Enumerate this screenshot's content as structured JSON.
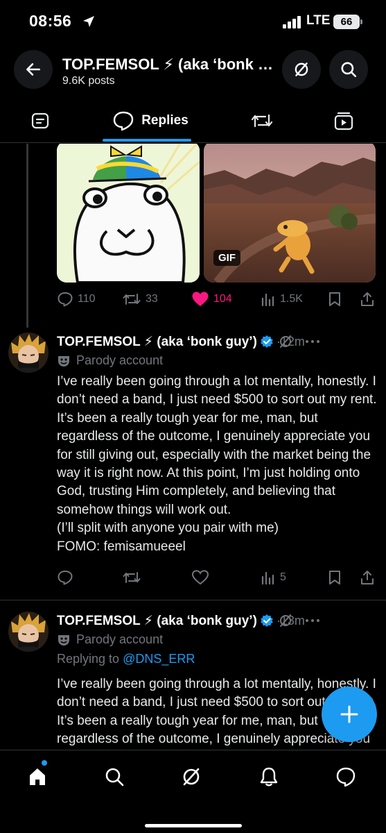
{
  "status_bar": {
    "time": "08:56",
    "network": "LTE",
    "battery": "66"
  },
  "header": {
    "title": "TOP.FEMSOL ⚡ (aka ‘bonk guy’)",
    "subtitle": "9.6K posts"
  },
  "tabs": [
    {
      "label": "",
      "icon": "post-icon"
    },
    {
      "label": "Replies",
      "icon": "reply-bubble-icon",
      "active": true
    },
    {
      "label": "",
      "icon": "repost-icon"
    },
    {
      "label": "",
      "icon": "media-icon"
    }
  ],
  "media": {
    "gif_badge": "GIF"
  },
  "top_actions": {
    "replies": "110",
    "reposts": "33",
    "likes": "104",
    "views": "1.5K"
  },
  "posts": [
    {
      "name": "TOP.FEMSOL ⚡ (aka ‘bonk guy’)",
      "time": "·12m",
      "badge": "Parody account",
      "body": "I’ve really been going through a lot mentally, honestly. I don’t need a band, I just need $500 to sort out my rent. It’s been a really tough year for me, man, but regardless of the outcome, I genuinely appreciate you for still giving out, especially with the market being the way it is right now. At this point, I’m just holding onto God, trusting Him completely, and believing that somehow things will work out.\n(I’ll split with anyone you pair with me)\nFOMO: femisamueeel",
      "views": "5"
    },
    {
      "name": "TOP.FEMSOL ⚡ (aka ‘bonk guy’)",
      "time": "·13m",
      "badge": "Parody account",
      "reply_prefix": "Replying to ",
      "reply_to": "@DNS_ERR",
      "body": "I’ve really been going through a lot mentally, honestly. I don’t need a band, I just need $500 to sort out my rent. It’s been a really tough year for me, man, but regardless of the outcome, I genuinely appreciate you for still giving out"
    }
  ],
  "colors": {
    "accent": "#1d9bf0",
    "like": "#f91880",
    "muted": "#71767b",
    "background": "#000000"
  }
}
